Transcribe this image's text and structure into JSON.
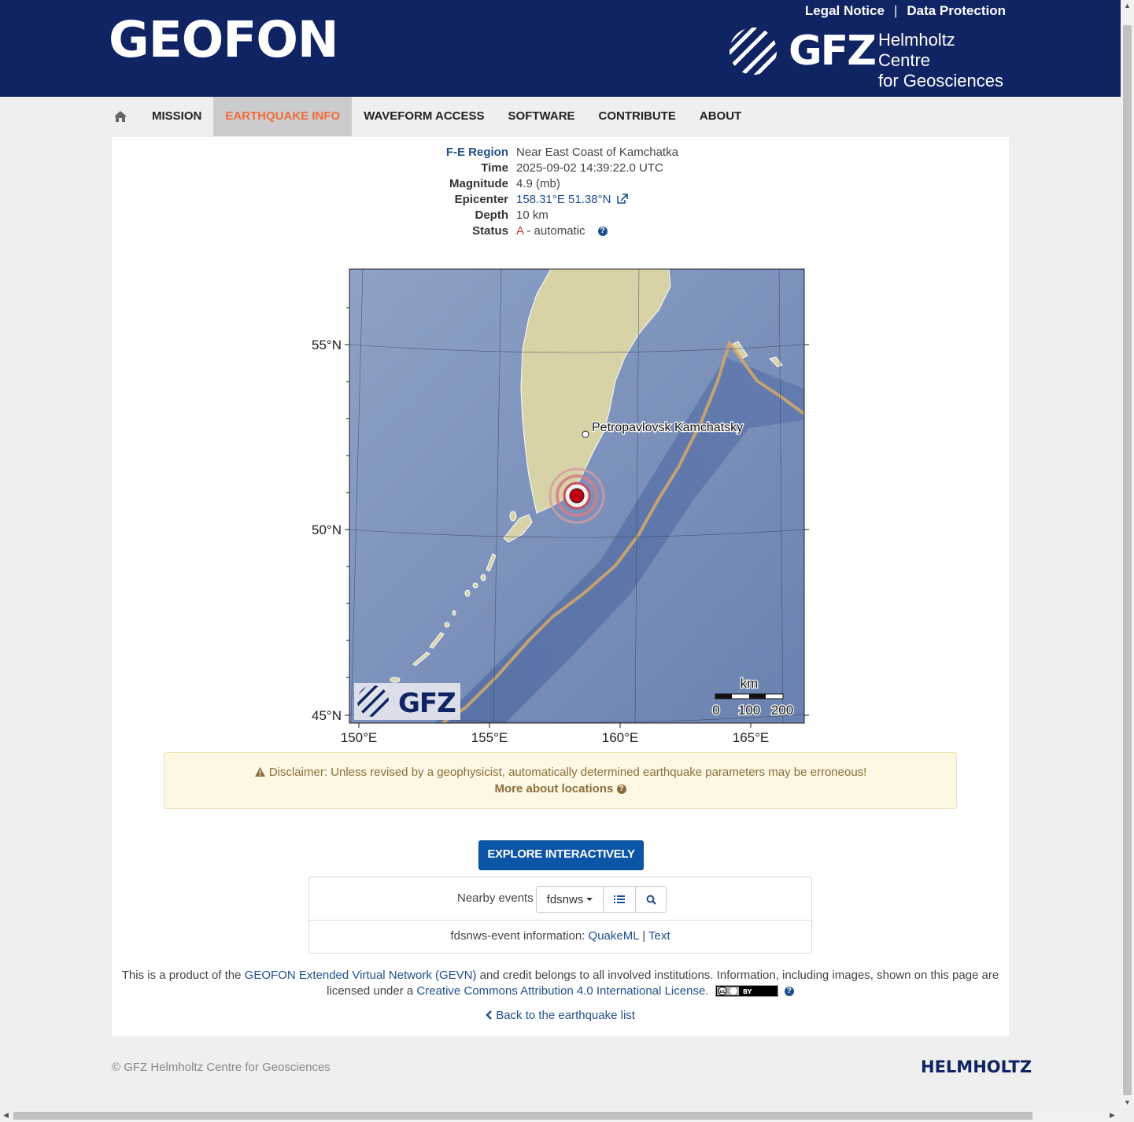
{
  "header": {
    "brand": "GEOFON",
    "legal_notice": "Legal Notice",
    "separator": "|",
    "data_protection": "Data Protection",
    "gfz_word": "GFZ",
    "gfz_sub_line1": "Helmholtz Centre",
    "gfz_sub_line2": "for Geosciences"
  },
  "nav": {
    "items": [
      "MISSION",
      "EARTHQUAKE INFO",
      "WAVEFORM ACCESS",
      "SOFTWARE",
      "CONTRIBUTE",
      "ABOUT"
    ],
    "active": "EARTHQUAKE INFO",
    "active_color": "#f26b3a"
  },
  "event": {
    "region_label": "F-E Region",
    "region": "Near East Coast of Kamchatka",
    "time_label": "Time",
    "time": "2025-09-02 14:39:22.0 UTC",
    "magnitude_label": "Magnitude",
    "magnitude": "4.9 (mb)",
    "epicenter_label": "Epicenter",
    "epicenter": "158.31°E 51.38°N",
    "depth_label": "Depth",
    "depth": "10 km",
    "status_label": "Status",
    "status_code": "A",
    "status_text": " - automatic"
  },
  "map": {
    "lat_labels": [
      "55°N",
      "50°N",
      "45°N"
    ],
    "lon_labels": [
      "150°E",
      "155°E",
      "160°E",
      "165°E"
    ],
    "city": "Petropavlovsk Kamchatsky",
    "scale_unit": "km",
    "scale_ticks": [
      "0",
      "100",
      "200"
    ],
    "logo_text": "GFZ"
  },
  "disclaimer": {
    "text": "Disclaimer: Unless revised by a geophysicist, automatically determined earthquake parameters may be erroneous!",
    "more": "More about locations"
  },
  "explore_button": "EXPLORE INTERACTIVELY",
  "nearby": {
    "label": "Nearby events",
    "service": "fdsnws",
    "info_prefix": "fdsnws-event information: ",
    "quakeml": "QuakeML",
    "pipe": " | ",
    "text_link": "Text"
  },
  "credit": {
    "p1": "This is a product of the ",
    "gevn": "GEOFON Extended Virtual Network (GEVN)",
    "p2": " and credit belongs to all involved institutions. Information, including images, shown on this page are",
    "p3": "licensed under a ",
    "license": "Creative Commons Attribution 4.0 International License",
    "p4": "."
  },
  "back_link": "Back to the earthquake list",
  "footer": {
    "copyright": "© GFZ Helmholtz Centre for Geosciences",
    "helmholtz": "HELMHOLTZ"
  }
}
